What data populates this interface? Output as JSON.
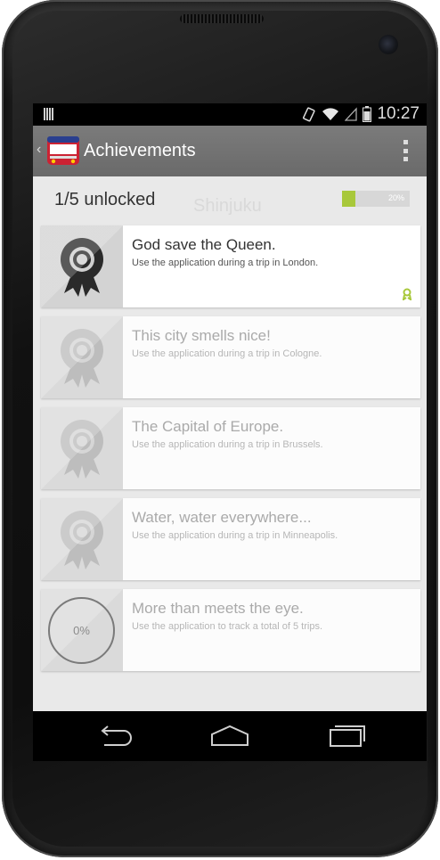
{
  "status_bar": {
    "time": "10:27",
    "icons": [
      "notification-icon",
      "vibrate-icon",
      "wifi-icon",
      "signal-icon",
      "battery-icon"
    ]
  },
  "action_bar": {
    "title": "Achievements",
    "app_icon": "bus-icon",
    "overflow_icon": "overflow-menu-icon",
    "color": "#707070"
  },
  "summary": {
    "unlocked_text": "1/5 unlocked",
    "progress_percent": 20,
    "progress_label": "20%",
    "progress_color": "#a8c83a"
  },
  "achievements": [
    {
      "title": "God save the Queen.",
      "description": "Use the application during a trip in London.",
      "unlocked": true,
      "badge_icon": "award-ribbon-icon"
    },
    {
      "title": "This city smells nice!",
      "description": "Use the application during a trip in Cologne.",
      "unlocked": false,
      "badge_icon": "award-ribbon-icon"
    },
    {
      "title": "The Capital of Europe.",
      "description": "Use the application during a trip in Brussels.",
      "unlocked": false,
      "badge_icon": "award-ribbon-icon"
    },
    {
      "title": "Water, water everywhere...",
      "description": "Use the application during a trip in Minneapolis.",
      "unlocked": false,
      "badge_icon": "award-ribbon-icon"
    },
    {
      "title": "More than meets the eye.",
      "description": "Use the application to track a total of 5 trips.",
      "unlocked": false,
      "progress_label": "0%"
    }
  ],
  "ghost_text": {
    "summary_city": "Shinjuku"
  },
  "nav_bar": {
    "buttons": [
      "back-icon",
      "home-icon",
      "recents-icon"
    ]
  }
}
